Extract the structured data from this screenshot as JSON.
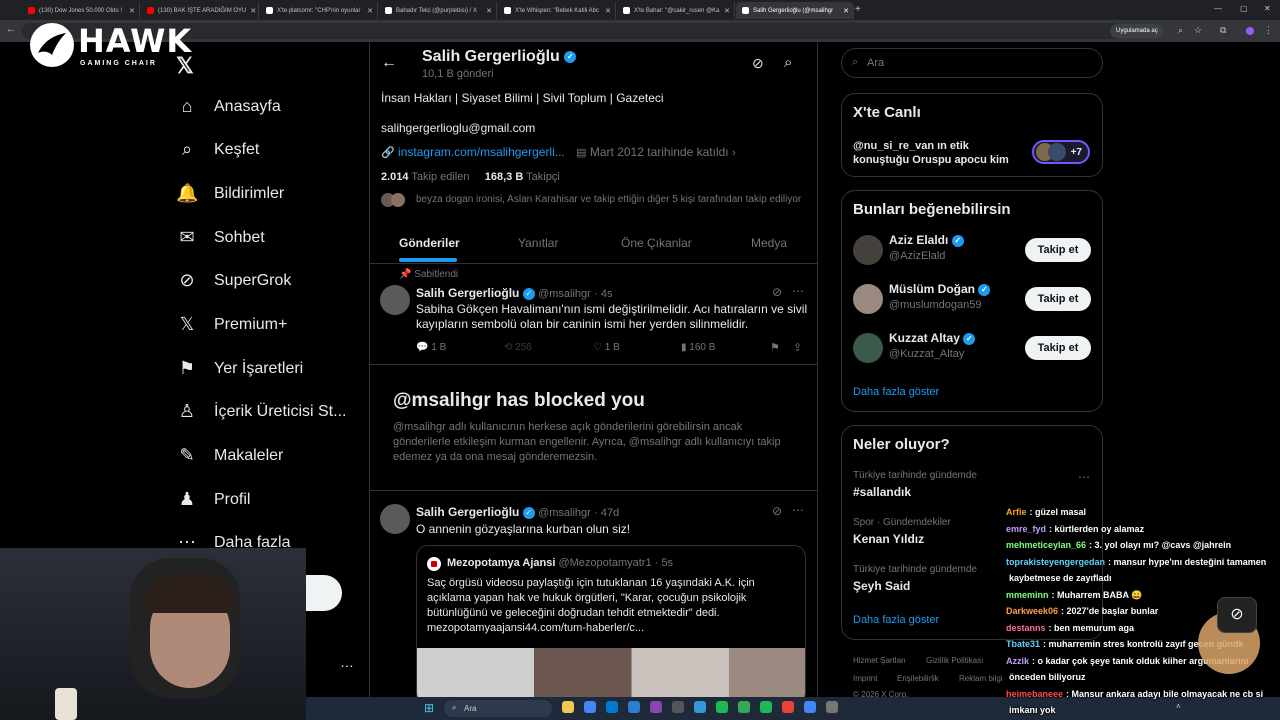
{
  "browser": {
    "tabs": [
      {
        "title": "(130) Dow Jones 50.000 Oldu !",
        "fav_color": "#ff0000"
      },
      {
        "title": "(130) BAK İŞTE ARADIĞIM OYU",
        "fav_color": "#ff0000"
      },
      {
        "title": "X'te platcomr: \"CHP'nin oyunlar",
        "fav_color": "#ffffff"
      },
      {
        "title": "Bahadır Telci (@purplebisi) / X",
        "fav_color": "#ffffff"
      },
      {
        "title": "X'te Whispen: \"Bebek Katili Abc",
        "fav_color": "#ffffff"
      },
      {
        "title": "X'te Bahar: \"@cakir_rusen @Ka",
        "fav_color": "#ffffff"
      },
      {
        "title": "Salih Gergerlioğlu (@msalihgr",
        "fav_color": "#ffffff"
      }
    ],
    "app_button": "Uygulamada aç"
  },
  "overlay": {
    "brand": "HAWK",
    "brand_sub": "GAMING CHAIR"
  },
  "sidebar": {
    "items": [
      {
        "label": "Anasayfa",
        "icon": "⌂"
      },
      {
        "label": "Keşfet",
        "icon": "⌕"
      },
      {
        "label": "Bildirimler",
        "icon": "🔔"
      },
      {
        "label": "Sohbet",
        "icon": "✉"
      },
      {
        "label": "SuperGrok",
        "icon": "⊘"
      },
      {
        "label": "Premium+",
        "icon": "𝕏"
      },
      {
        "label": "Yer İşaretleri",
        "icon": "⚑"
      },
      {
        "label": "İçerik Üreticisi St...",
        "icon": "♙"
      },
      {
        "label": "Makaleler",
        "icon": "✎"
      },
      {
        "label": "Profil",
        "icon": "♟"
      },
      {
        "label": "Daha fazla",
        "icon": "⋯"
      }
    ]
  },
  "profile": {
    "name": "Salih Gergerlioğlu",
    "post_count": "10,1 B gönderi",
    "bio": "İnsan Hakları | Siyaset Bilimi | Sivil Toplum | Gazeteci",
    "email": "salihgergerlioglu@gmail.com",
    "link": "instagram.com/msalihgergerli...",
    "joined": "Mart 2012 tarihinde katıldı",
    "following_count": "2.014",
    "following_label": "Takip edilen",
    "followers_count": "168,3 B",
    "followers_label": "Takipçi",
    "followed_by": "beyza dogan ironisi, Aslan Karahisar ve takip ettiğin diğer 5 kişi tarafından takip ediliyor",
    "tabs": [
      "Gönderiler",
      "Yanıtlar",
      "Öne Çıkanlar",
      "Medya"
    ]
  },
  "pinned_post": {
    "pinned_label": "Sabitlendi",
    "name": "Salih Gergerlioğlu",
    "handle": "@msalihgr",
    "time": "· 4s",
    "text": "Sabiha Gökçen Havalimanı'nın ismi değiştirilmelidir. Acı hatıraların ve sivil kayıpların sembolü olan bir caninin ismi her yerden silinmelidir.",
    "replies": "1 B",
    "reposts": "256",
    "likes": "1 B",
    "views": "160 B"
  },
  "blocked": {
    "title": "@msalihgr has blocked you",
    "text": "@msalihgr adlı kullanıcının herkese açık gönderilerini görebilirsin ancak gönderilerle etkileşim kurman engellenir. Ayrıca, @msalihgr adlı kullanıcıyı takip edemez ya da ona mesaj gönderemezsin."
  },
  "post2": {
    "name": "Salih Gergerlioğlu",
    "handle": "@msalihgr",
    "time": "· 47d",
    "text": "O annenin gözyaşlarına kurban olun siz!",
    "quote_name": "Mezopotamya Ajansi",
    "quote_handle": "@Mezopotamyatr1",
    "quote_time": "· 5s",
    "quote_text": "Saç örgüsü videosu paylaştığı için tutuklanan 16 yaşındaki A.K. için açıklama yapan hak ve hukuk örgütleri, \"Karar, çocuğun psikolojik bütünlüğünü ve geleceğini doğrudan tehdit etmektedir\" dedi. mezopotamyaajansi44.com/tum-haberler/c..."
  },
  "right": {
    "search_placeholder": "Ara",
    "live_title": "X'te Canlı",
    "live_text": "@nu_si_re_van ın etik konuştuğu Oruspu apocu kim",
    "live_count": "+7",
    "suggest_title": "Bunları beğenebilirsin",
    "suggestions": [
      {
        "name": "Aziz Elaldı",
        "handle": "@AzizElald",
        "button": "Takip et"
      },
      {
        "name": "Müslüm Doğan",
        "handle": "@muslumdogan59",
        "button": "Takip et"
      },
      {
        "name": "Kuzzat Altay",
        "handle": "@Kuzzat_Altay",
        "button": "Takip et"
      }
    ],
    "show_more": "Daha fazla göster",
    "trends_title": "Neler oluyor?",
    "trends": [
      {
        "context": "Türkiye tarihinde gündemde",
        "name": "#sallandık"
      },
      {
        "context": "Spor · Gündemdekiler",
        "name": "Kenan Yıldız"
      },
      {
        "context": "Türkiye tarihinde gündemde",
        "name": "Şeyh Said"
      }
    ],
    "footer": [
      "Hizmet Şartları",
      "Gizlilik Politikası",
      "Imprint",
      "Erişilebilirlik",
      "Reklam bilgi",
      "© 2026 X Corp."
    ]
  },
  "chat": [
    {
      "user": "Arfie",
      "color": "#f5a623",
      "msg": ": güzel masal"
    },
    {
      "user": "emre_fyd",
      "color": "#c39bff",
      "msg": ": kürtlerden oy alamaz"
    },
    {
      "user": "mehmeticeylan_66",
      "color": "#7cff7c",
      "msg": ": 3. yol olayı mı? @cavs @jahrein"
    },
    {
      "user": "toprakisteyengergedan",
      "color": "#5fd1ff",
      "msg": ": mansur hype'ını desteğini tamamen"
    },
    {
      "user": "",
      "color": "#ffffff",
      "msg": "kaybetmese de zayıfladı"
    },
    {
      "user": "mmeminn",
      "color": "#7cff7c",
      "msg": ": Muharrem BABA 😄"
    },
    {
      "user": "Darkweek06",
      "color": "#ff9f43",
      "msg": ": 2027'de başlar bunlar"
    },
    {
      "user": "destanns",
      "color": "#ff6b9d",
      "msg": ": ben memurum aga"
    },
    {
      "user": "Tbate31",
      "color": "#5fd1ff",
      "msg": ": muharremin stres kontrolü zayıf gecen gündk"
    },
    {
      "user": "Azzik",
      "color": "#c39bff",
      "msg": ": o kadar çok şeye tanık olduk kiiher argumanlarını"
    },
    {
      "user": "",
      "color": "#ffffff",
      "msg": "önceden biliyoruz"
    },
    {
      "user": "heimebaneee",
      "color": "#ff4d4d",
      "msg": ": Mansur ankara adayı bile olmayacak ne cb si"
    },
    {
      "user": "",
      "color": "#ffffff",
      "msg": "imkanı yok"
    }
  ],
  "taskbar": {
    "search": "Ara"
  }
}
